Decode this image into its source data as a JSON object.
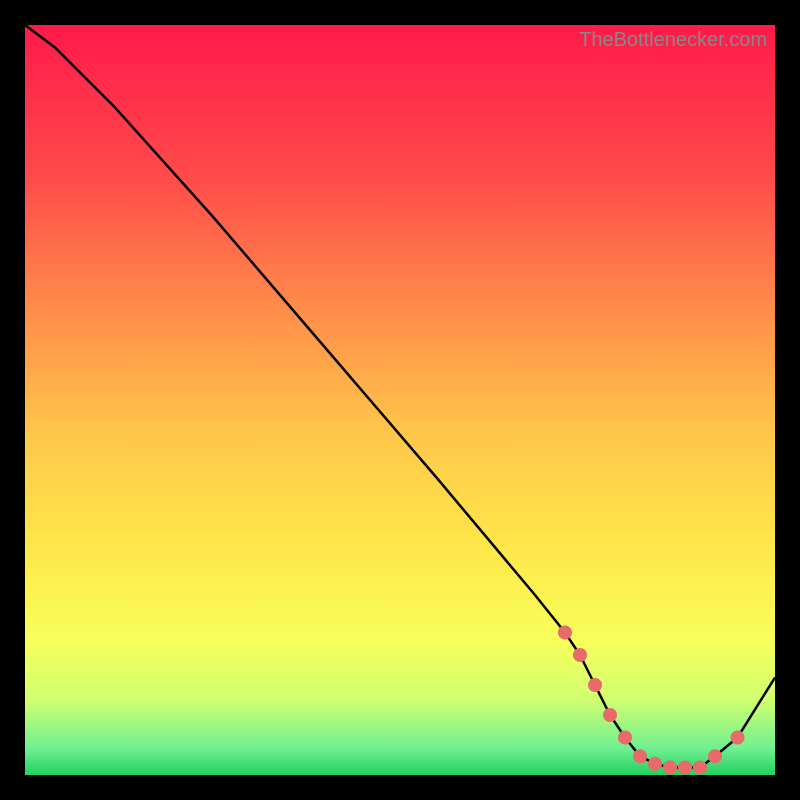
{
  "watermark": "TheBottlenecker.com",
  "colors": {
    "line": "#000000",
    "dot": "#e86a6a",
    "frame_bg": "#000000"
  },
  "chart_data": {
    "type": "line",
    "title": "",
    "xlabel": "",
    "ylabel": "",
    "xlim": [
      0,
      100
    ],
    "ylim": [
      0,
      100
    ],
    "x": [
      0,
      4,
      8,
      12,
      25,
      40,
      55,
      68,
      72,
      74,
      76,
      78,
      80,
      82,
      84,
      86,
      88,
      90,
      92,
      95,
      100
    ],
    "values": [
      100,
      97,
      93,
      89,
      74.5,
      57,
      39.5,
      24,
      19,
      16,
      12,
      8,
      5,
      2.5,
      1.5,
      1,
      1,
      1,
      2.5,
      5,
      13
    ],
    "highlight_points": [
      {
        "x": 72,
        "y": 19
      },
      {
        "x": 74,
        "y": 16
      },
      {
        "x": 76,
        "y": 12
      },
      {
        "x": 78,
        "y": 8
      },
      {
        "x": 80,
        "y": 5
      },
      {
        "x": 82,
        "y": 2.5
      },
      {
        "x": 84,
        "y": 1.5
      },
      {
        "x": 86,
        "y": 1
      },
      {
        "x": 88,
        "y": 1
      },
      {
        "x": 90,
        "y": 1
      },
      {
        "x": 92,
        "y": 2.5
      },
      {
        "x": 95,
        "y": 5
      }
    ],
    "gradient_stops": [
      {
        "offset": 0.0,
        "color": "#ff1a4a"
      },
      {
        "offset": 0.2,
        "color": "#ff4a4a"
      },
      {
        "offset": 0.4,
        "color": "#ff944a"
      },
      {
        "offset": 0.55,
        "color": "#ffc84a"
      },
      {
        "offset": 0.7,
        "color": "#ffe84a"
      },
      {
        "offset": 0.82,
        "color": "#f8ff5a"
      },
      {
        "offset": 0.9,
        "color": "#d0ff70"
      },
      {
        "offset": 0.965,
        "color": "#70f090"
      },
      {
        "offset": 1.0,
        "color": "#20d060"
      }
    ]
  }
}
